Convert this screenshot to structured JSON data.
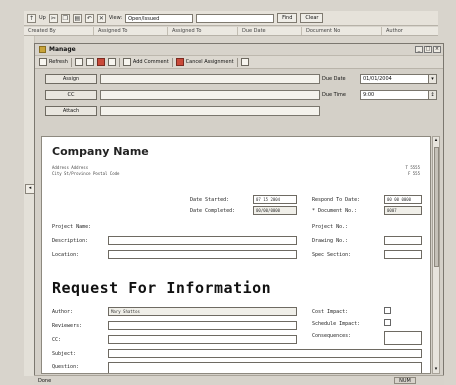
{
  "outer_toolbar": {
    "items": [
      "Up",
      "Cut",
      "Copy",
      "Paste",
      "Undo",
      "Delete"
    ],
    "view_label": "View:",
    "view_value": "Open/Issued",
    "search_value": "",
    "find_label": "Find",
    "clear_label": "Clear"
  },
  "outer_columns": [
    "Created By",
    "Assigned To",
    "Assigned To",
    "Due Date",
    "Document No",
    "Author"
  ],
  "window": {
    "title": "Manage",
    "min": "_",
    "max": "□",
    "close": "×"
  },
  "window_toolbar": {
    "refresh_label": "Refresh",
    "add_comment_label": "Add Comment",
    "cancel_assignment_label": "Cancel Assignment"
  },
  "header_fields": {
    "assign_label": "Assign",
    "cc_label": "CC",
    "attach_label": "Attach",
    "due_date_label": "Due Date",
    "due_date_value": "01/01/2004",
    "due_time_label": "Due Time",
    "due_time_value": "9:00"
  },
  "document": {
    "company_name": "Company Name",
    "address_line1": "Address  Address",
    "address_line2": "City  St/Province  Postal Code",
    "phone_line1": "T 5555",
    "phone_line2": "F 555",
    "date_started_label": "Date Started:",
    "date_started_value": "07 15 2004",
    "date_completed_label": "Date Completed:",
    "date_completed_value": "00/00/0000",
    "respond_by_label": "Respond To Date:",
    "respond_by_value": "00 00 0000",
    "document_no_label": "* Document No.:",
    "document_no_value": "0007",
    "project_name_label": "Project Name:",
    "project_no_label": "Project No.:",
    "description_label": "Description:",
    "drawing_no_label": "Drawing No.:",
    "location_label": "Location:",
    "spec_section_label": "Spec Section:",
    "rfi_title": "Request For Information",
    "author_label": "Author:",
    "author_value": "Mary Shattos",
    "reviewers_label": "Reviewers:",
    "cc_label": "CC:",
    "subject_label": "Subject:",
    "question_label": "Question:",
    "cost_impact_label": "Cost Impact:",
    "schedule_impact_label": "Schedule Impact:",
    "consequences_label": "Consequences:"
  },
  "status": {
    "text": "Done",
    "indicator": "NUM"
  }
}
